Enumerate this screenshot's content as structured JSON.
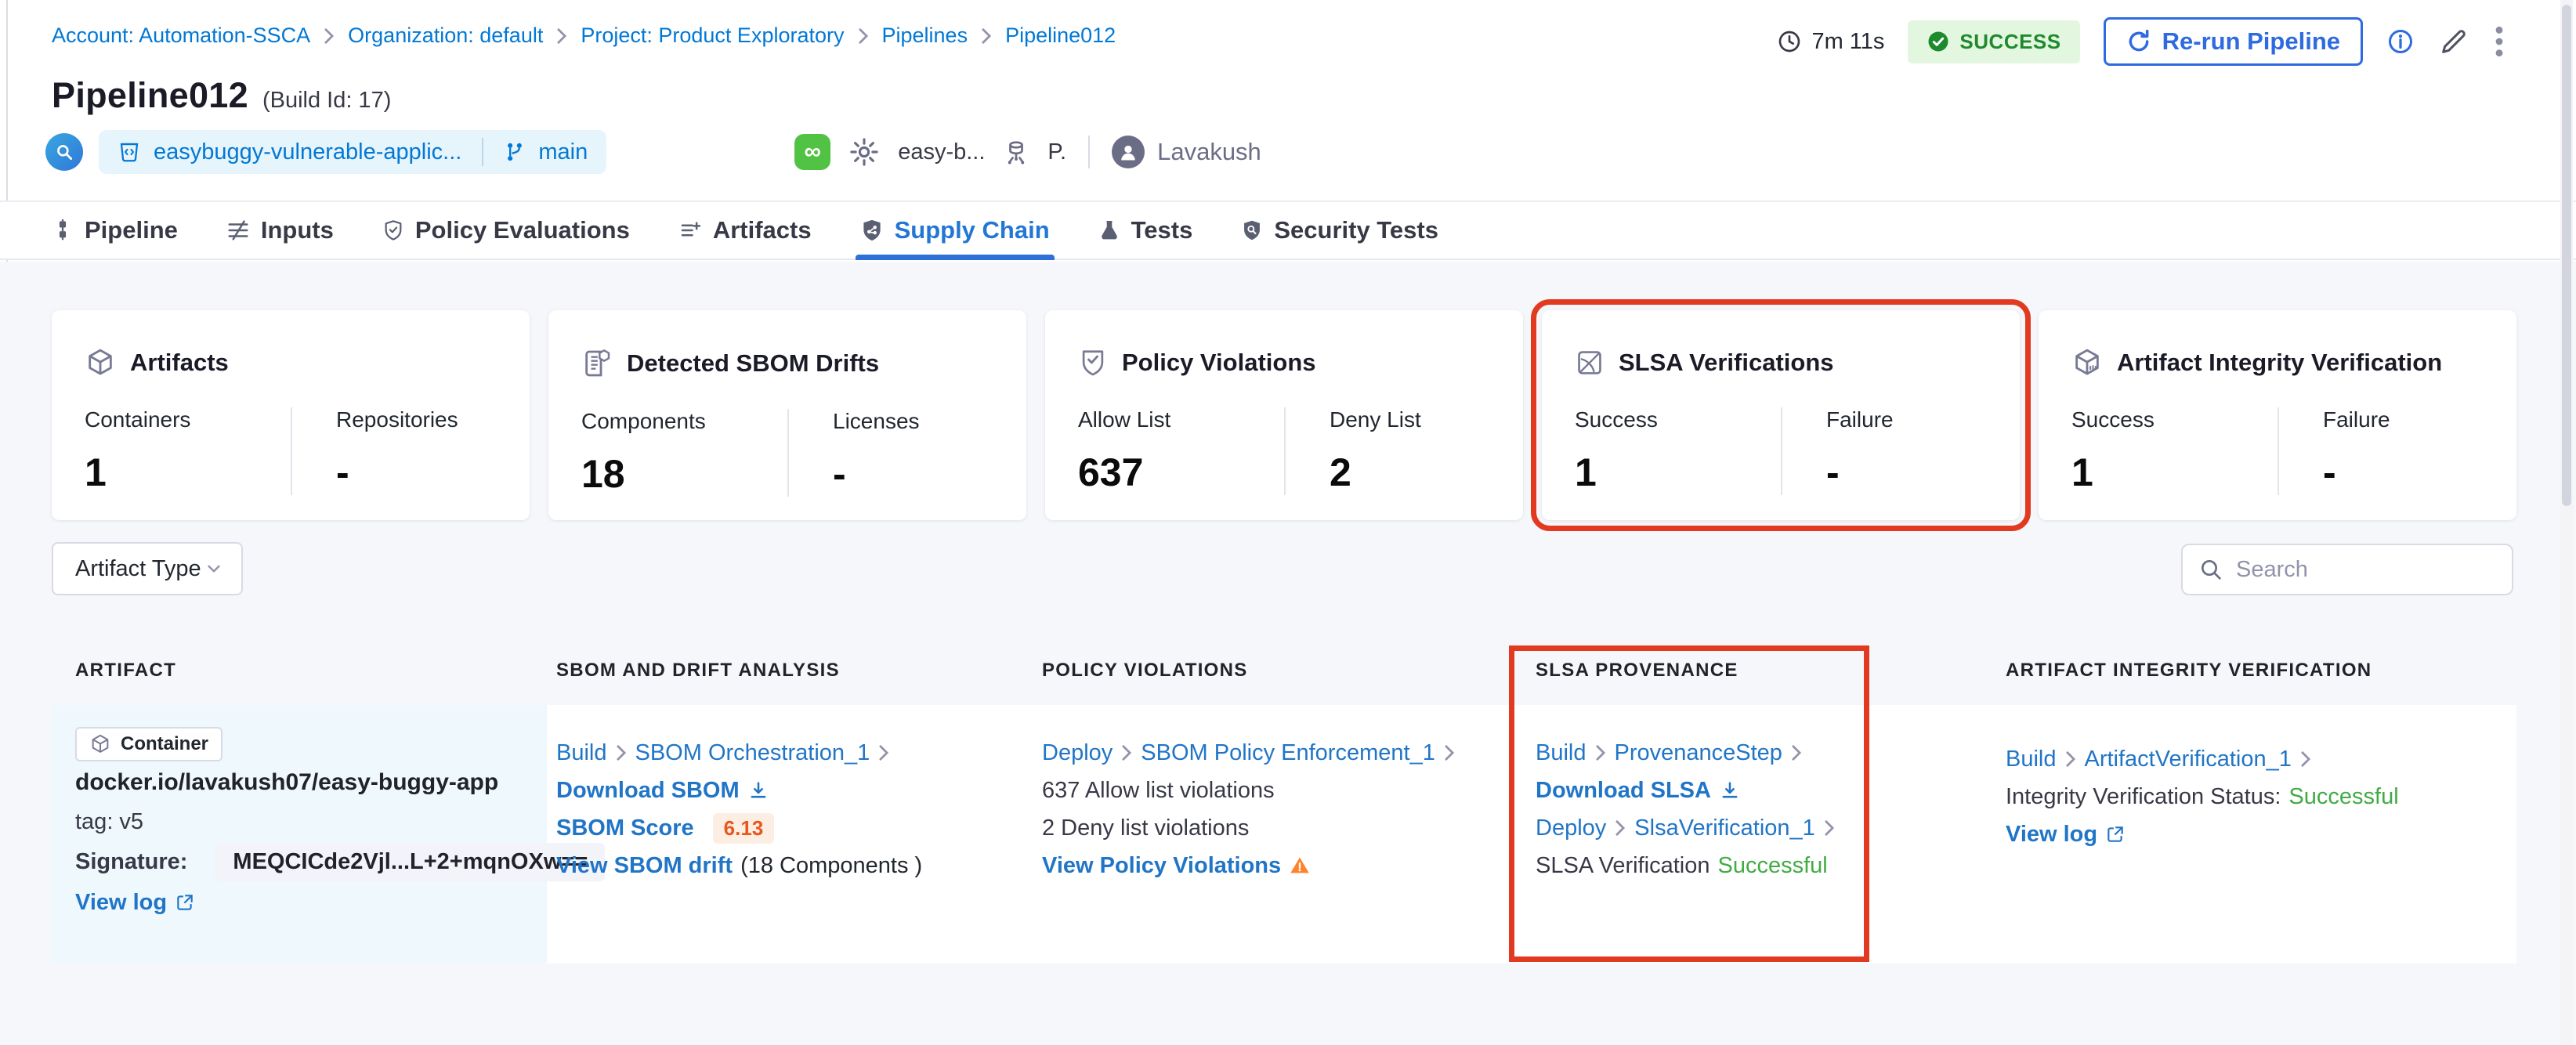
{
  "breadcrumb": {
    "items": [
      "Account: Automation-SSCA",
      "Organization: default",
      "Project: Product Exploratory",
      "Pipelines",
      "Pipeline012"
    ]
  },
  "header": {
    "duration": "7m 11s",
    "status": "SUCCESS",
    "rerun_label": "Re-run Pipeline",
    "title": "Pipeline012",
    "build_id": "(Build Id: 17)",
    "repo_name": "easybuggy-vulnerable-applic...",
    "branch": "main",
    "trigger_text": "easy-b...",
    "trigger_short": "P.",
    "user": "Lavakush"
  },
  "tabs": [
    {
      "label": "Pipeline"
    },
    {
      "label": "Inputs"
    },
    {
      "label": "Policy Evaluations"
    },
    {
      "label": "Artifacts"
    },
    {
      "label": "Supply Chain"
    },
    {
      "label": "Tests"
    },
    {
      "label": "Security Tests"
    }
  ],
  "cards": [
    {
      "title": "Artifacts",
      "stats": [
        {
          "label": "Containers",
          "value": "1"
        },
        {
          "label": "Repositories",
          "value": "-"
        }
      ]
    },
    {
      "title": "Detected SBOM Drifts",
      "stats": [
        {
          "label": "Components",
          "value": "18"
        },
        {
          "label": "Licenses",
          "value": "-"
        }
      ]
    },
    {
      "title": "Policy Violations",
      "stats": [
        {
          "label": "Allow List",
          "value": "637"
        },
        {
          "label": "Deny List",
          "value": "2"
        }
      ]
    },
    {
      "title": "SLSA Verifications",
      "stats": [
        {
          "label": "Success",
          "value": "1"
        },
        {
          "label": "Failure",
          "value": "-"
        }
      ]
    },
    {
      "title": "Artifact Integrity Verification",
      "stats": [
        {
          "label": "Success",
          "value": "1"
        },
        {
          "label": "Failure",
          "value": "-"
        }
      ]
    }
  ],
  "filters": {
    "artifact_type": "Artifact Type",
    "search_placeholder": "Search"
  },
  "table": {
    "headers": [
      "ARTIFACT",
      "SBOM AND DRIFT ANALYSIS",
      "POLICY VIOLATIONS",
      "SLSA PROVENANCE",
      "ARTIFACT INTEGRITY VERIFICATION"
    ],
    "row": {
      "artifact": {
        "type": "Container",
        "image": "docker.io/lavakush07/easy-buggy-app",
        "tag": "tag: v5",
        "signature_label": "Signature:",
        "signature": "MEQCICde2Vjl...L+2+mqnOXw==",
        "view_log": "View log"
      },
      "sbom": {
        "stage": "Build",
        "step": "SBOM Orchestration_1",
        "download": "Download SBOM",
        "score_label": "SBOM Score",
        "score": "6.13",
        "drift_link": "View SBOM drift",
        "drift_info": "(18 Components )"
      },
      "policy": {
        "stage": "Deploy",
        "step": "SBOM Policy Enforcement_1",
        "allow": "637 Allow list violations",
        "deny": "2 Deny list violations",
        "view": "View Policy Violations"
      },
      "slsa": {
        "stage1": "Build",
        "step1": "ProvenanceStep",
        "download": "Download SLSA",
        "stage2": "Deploy",
        "step2": "SlsaVerification_1",
        "status_label": "SLSA Verification ",
        "status": "Successful"
      },
      "integrity": {
        "stage": "Build",
        "step": "ArtifactVerification_1",
        "status_label": "Integrity Verification Status: ",
        "status": "Successful",
        "view_log": "View log"
      }
    }
  },
  "colors": {
    "accent_blue": "#0278d5",
    "button_blue": "#2e6be0",
    "highlight_red": "#e23a20",
    "success_green": "#42ab45",
    "badge_green_bg": "#e3f6df",
    "badge_green_text": "#1f8a2d",
    "score_orange": "#e8571f",
    "warning_orange": "#ff832b"
  }
}
